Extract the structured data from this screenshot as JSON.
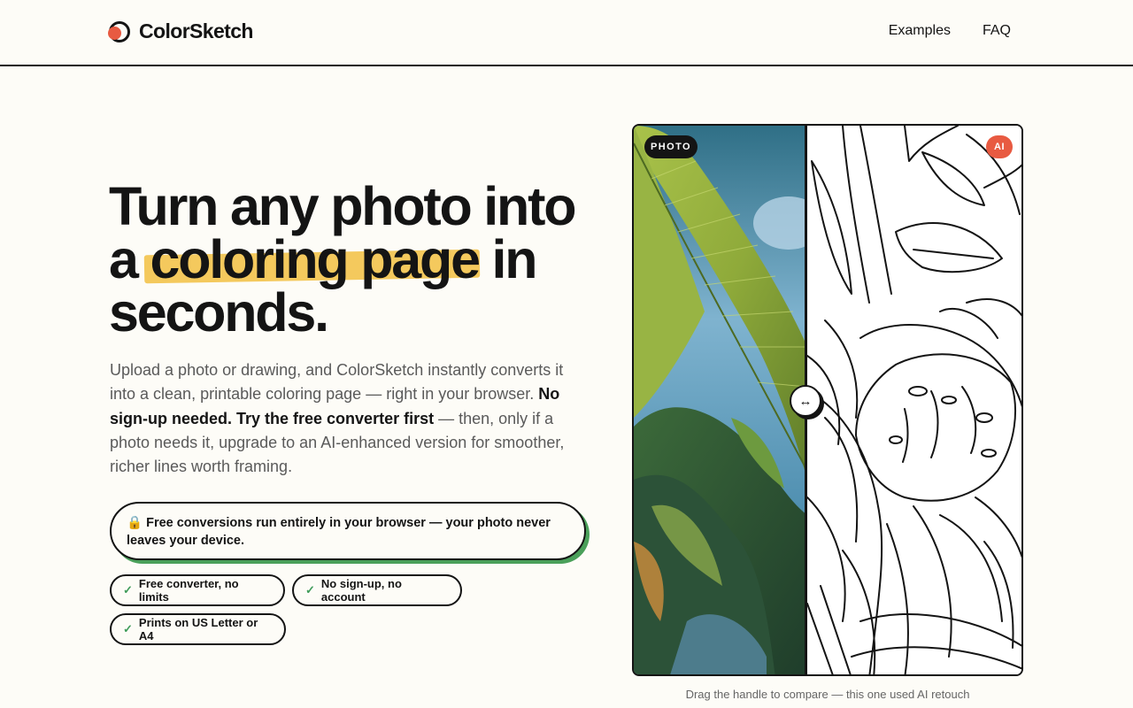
{
  "brand": {
    "name": "ColorSketch"
  },
  "nav": {
    "items": [
      "Examples",
      "FAQ"
    ]
  },
  "hero": {
    "headline_part1": "Turn any photo into a ",
    "headline_highlight": "coloring page",
    "headline_part2": " in seconds.",
    "lede_intro": "Upload a photo or drawing, and ColorSketch instantly converts it into a clean, printable coloring page — right in your browser. ",
    "lede_bold": "No sign-up needed. Try the free converter first",
    "lede_outro": " — then, only if a photo needs it, upgrade to an AI-enhanced version for smoother, richer lines worth framing.",
    "privacy_note": "🔒 Free conversions run entirely in your browser — your photo never leaves your device.",
    "chips": [
      "Free converter, no limits",
      "No sign-up, no account",
      "Prints on US Letter or A4"
    ],
    "check_glyph": "✓"
  },
  "compare": {
    "photo_label": "PHOTO",
    "ai_label": "AI",
    "handle_glyph": "↔",
    "caption": "Drag the handle to compare — this one used AI retouch"
  },
  "colors": {
    "accent": "#e85a41",
    "highlight": "#f4c95d",
    "check": "#3f9c5a",
    "shadow": "#4aa05a",
    "ink": "#141414",
    "background": "#fdfcf7"
  },
  "icons": {
    "logo": "palette-logo-icon",
    "lock": "lock-icon",
    "check": "check-icon",
    "drag": "drag-arrows-icon"
  }
}
